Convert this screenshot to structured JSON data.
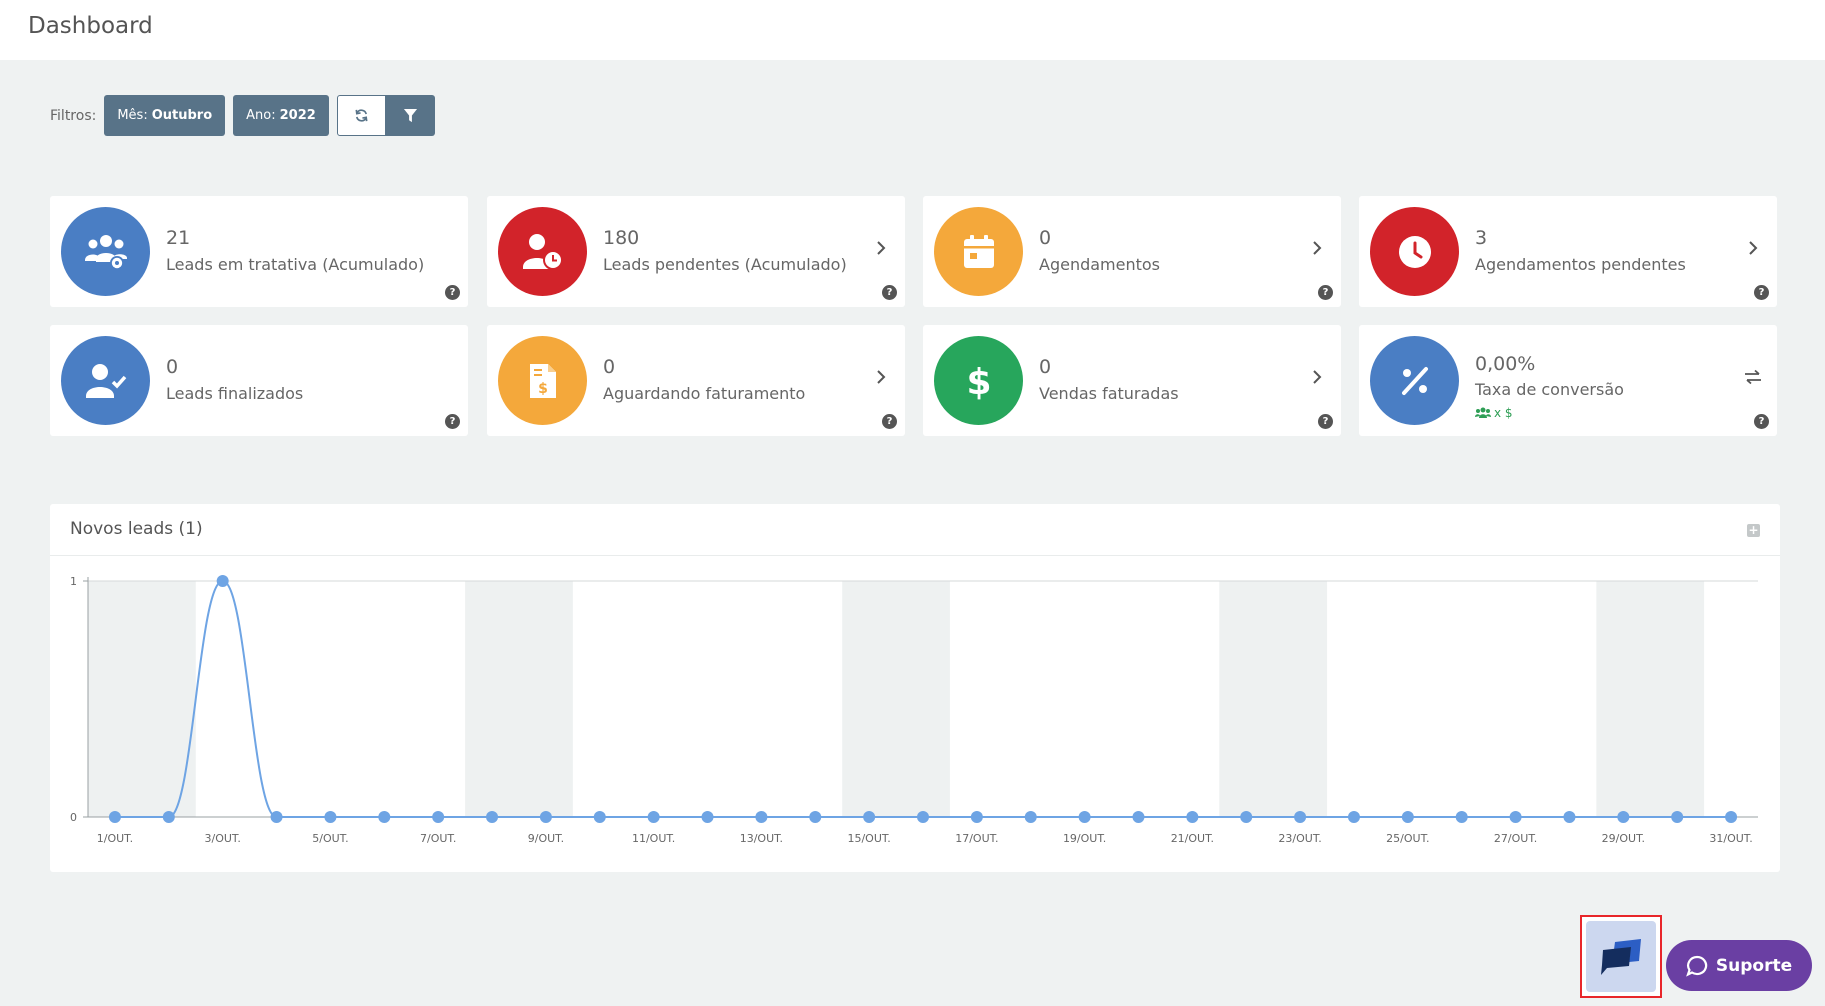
{
  "header": {
    "title": "Dashboard"
  },
  "filters": {
    "label": "Filtros:",
    "month_label": "Mês:",
    "month_value": "Outubro",
    "year_label": "Ano:",
    "year_value": "2022"
  },
  "cards": [
    {
      "value": "21",
      "label": "Leads em tratativa (Acumulado)",
      "color": "#4a7ec4",
      "icon": "users-gear-icon",
      "has_chevron": false
    },
    {
      "value": "180",
      "label": "Leads pendentes (Acumulado)",
      "color": "#d2232a",
      "icon": "user-clock-icon",
      "has_chevron": true
    },
    {
      "value": "0",
      "label": "Agendamentos",
      "color": "#f4a83b",
      "icon": "calendar-icon",
      "has_chevron": true
    },
    {
      "value": "3",
      "label": "Agendamentos pendentes",
      "color": "#d2232a",
      "icon": "clock-icon",
      "has_chevron": true
    },
    {
      "value": "0",
      "label": "Leads finalizados",
      "color": "#4a7ec4",
      "icon": "user-check-icon",
      "has_chevron": false
    },
    {
      "value": "0",
      "label": "Aguardando faturamento",
      "color": "#f4a83b",
      "icon": "invoice-icon",
      "has_chevron": true
    },
    {
      "value": "0",
      "label": "Vendas faturadas",
      "color": "#27a65c",
      "icon": "dollar-icon",
      "has_chevron": true
    },
    {
      "value": "0,00%",
      "label": "Taxa de conversão",
      "color": "#4a7ec4",
      "icon": "percent-icon",
      "has_chevron": false,
      "sub_text": "x $",
      "sub_color": "#2e9e55"
    }
  ],
  "help_text": "?",
  "panel": {
    "title": "Novos leads (1)",
    "expand_text": "+"
  },
  "chart_data": {
    "type": "line",
    "title": "",
    "categories": [
      "1/OUT.",
      "2/OUT.",
      "3/OUT.",
      "4/OUT.",
      "5/OUT.",
      "6/OUT.",
      "7/OUT.",
      "8/OUT.",
      "9/OUT.",
      "10/OUT.",
      "11/OUT.",
      "12/OUT.",
      "13/OUT.",
      "14/OUT.",
      "15/OUT.",
      "16/OUT.",
      "17/OUT.",
      "18/OUT.",
      "19/OUT.",
      "20/OUT.",
      "21/OUT.",
      "22/OUT.",
      "23/OUT.",
      "24/OUT.",
      "25/OUT.",
      "26/OUT.",
      "27/OUT.",
      "28/OUT.",
      "29/OUT.",
      "30/OUT.",
      "31/OUT."
    ],
    "tick_labels": [
      "1/OUT.",
      "3/OUT.",
      "5/OUT.",
      "7/OUT.",
      "9/OUT.",
      "11/OUT.",
      "13/OUT.",
      "15/OUT.",
      "17/OUT.",
      "19/OUT.",
      "21/OUT.",
      "23/OUT.",
      "25/OUT.",
      "27/OUT.",
      "29/OUT.",
      "31/OUT."
    ],
    "values": [
      0,
      0,
      1,
      0,
      0,
      0,
      0,
      0,
      0,
      0,
      0,
      0,
      0,
      0,
      0,
      0,
      0,
      0,
      0,
      0,
      0,
      0,
      0,
      0,
      0,
      0,
      0,
      0,
      0,
      0,
      0
    ],
    "ylim": [
      0,
      1
    ],
    "y_ticks": [
      "0",
      "1"
    ],
    "weekend_bands": [
      [
        "1/OUT.",
        "2/OUT."
      ],
      [
        "8/OUT.",
        "9/OUT."
      ],
      [
        "15/OUT.",
        "16/OUT."
      ],
      [
        "22/OUT.",
        "23/OUT."
      ],
      [
        "29/OUT.",
        "30/OUT."
      ]
    ],
    "line_color": "#6ea4e4",
    "band_color": "#eef1f1",
    "grid": true
  },
  "support": {
    "label": "Suporte"
  }
}
